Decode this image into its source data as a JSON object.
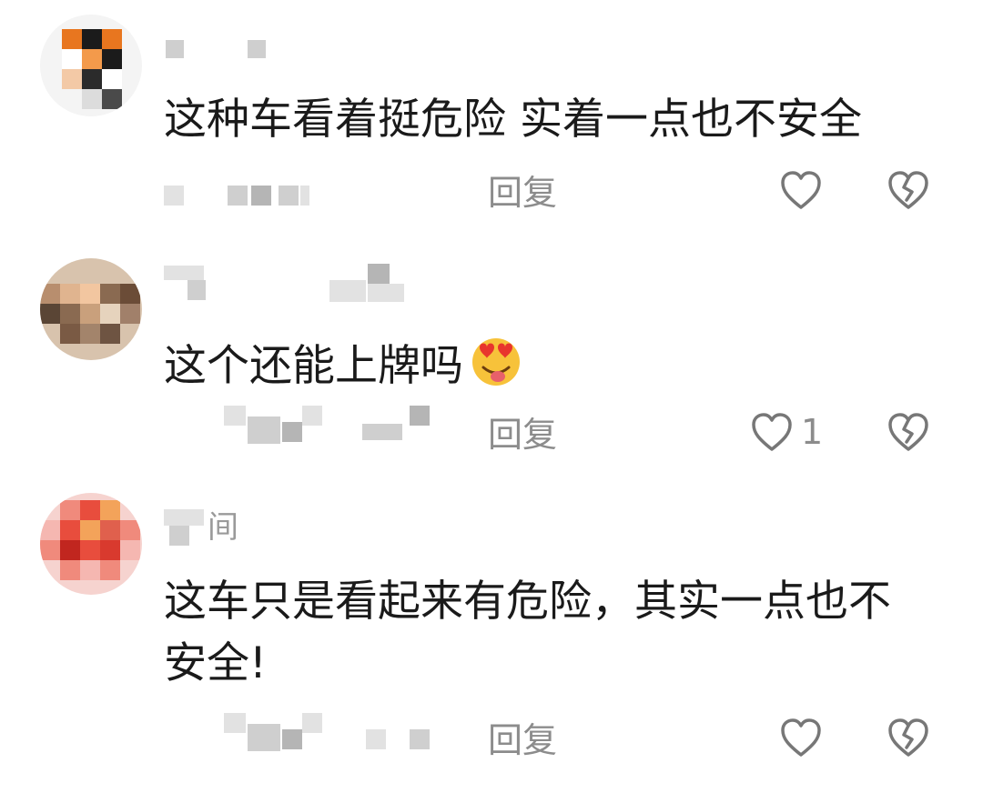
{
  "comments": [
    {
      "username": "",
      "text": "这种车看着挺危险 实着一点也不安全",
      "reply_label": "回复",
      "like_count": "",
      "avatar_colors": [
        "#e8761f",
        "#1b1b1b",
        "#ffffff",
        "#f3c9a6"
      ]
    },
    {
      "username": "",
      "text": "这个还能上牌吗",
      "reply_label": "回复",
      "like_count": "1",
      "avatar_colors": [
        "#d8b79a",
        "#8a6a51",
        "#5a4535",
        "#c9a07c"
      ]
    },
    {
      "username": "间",
      "text": "这车只是看起来有危险，其实一点也不安全!",
      "reply_label": "回复",
      "like_count": "",
      "avatar_colors": [
        "#e84d3d",
        "#f3a35a",
        "#c1261f",
        "#f5b7b1"
      ]
    }
  ],
  "icons": {
    "like": "heart-outline-icon",
    "dislike": "broken-heart-icon",
    "emoji": "heart-eyes-tongue-emoji"
  },
  "colors": {
    "text": "#1a1a1a",
    "muted": "#8c8c8c",
    "icon_stroke": "#777777"
  }
}
